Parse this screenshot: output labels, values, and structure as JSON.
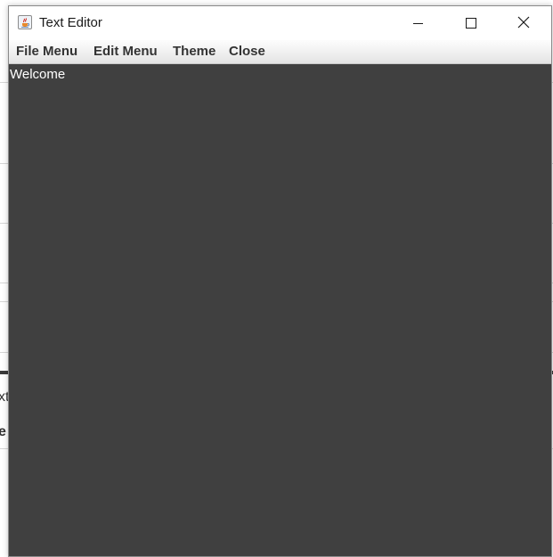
{
  "window": {
    "title": "Text Editor",
    "app_icon": "java-cup-icon"
  },
  "controls": {
    "minimize_icon": "minimize-icon",
    "maximize_icon": "maximize-icon",
    "close_icon": "close-icon"
  },
  "menu": {
    "items": [
      {
        "label": "File Menu"
      },
      {
        "label": "Edit Menu"
      },
      {
        "label": "Theme"
      },
      {
        "label": "Close"
      }
    ]
  },
  "editor": {
    "content": "Welcome",
    "background_color": "#404040",
    "text_color": "#ffffff"
  },
  "background": {
    "fragments": [
      "xt",
      "e"
    ]
  }
}
